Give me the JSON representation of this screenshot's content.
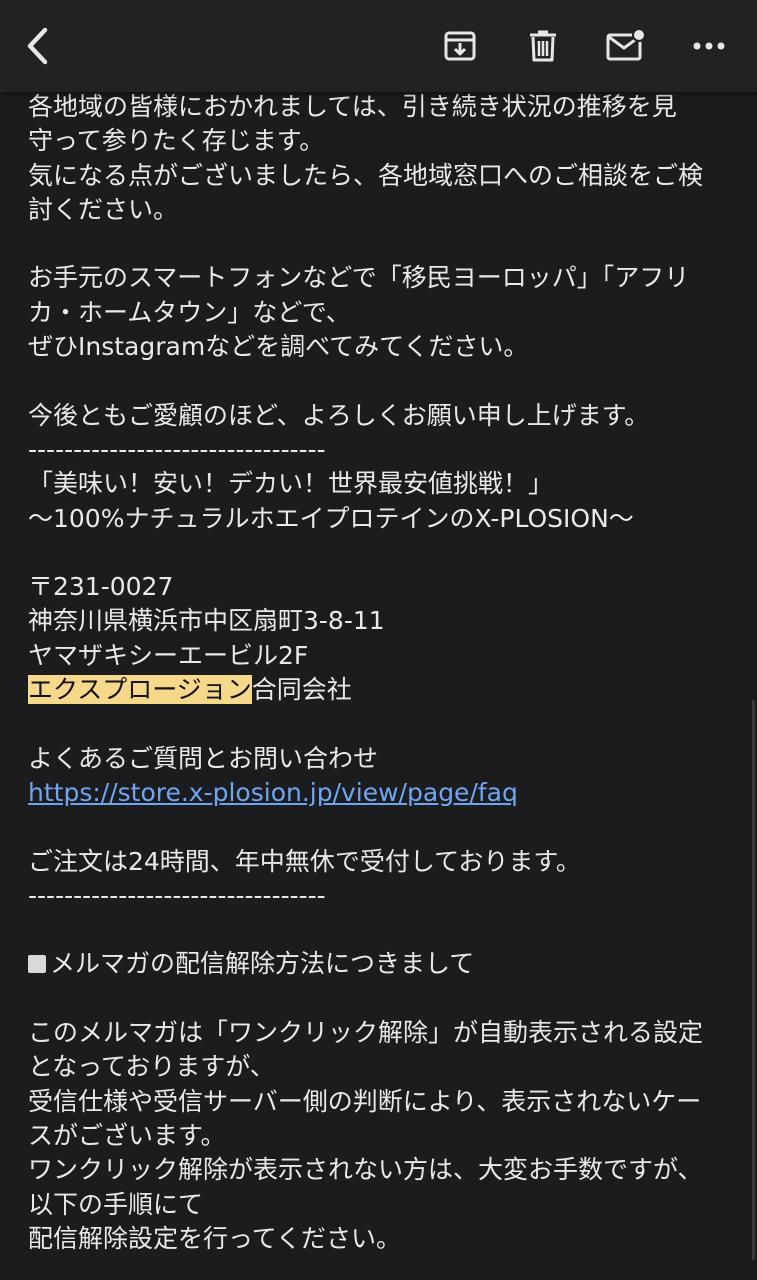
{
  "toolbar": {
    "back_icon": "chevron-left-icon",
    "archive_icon": "archive-icon",
    "delete_icon": "trash-icon",
    "mark_unread_icon": "mail-unread-icon",
    "more_icon": "more-horizontal-icon",
    "background": "#222225"
  },
  "email": {
    "lines": [
      "各地域の皆様におかれましては、引き続き状況の推移を見",
      "守って参りたく存じます。",
      "気になる点がございましたら、各地域窓口へのご相談をご検",
      "討ください。",
      "",
      "お手元のスマートフォンなどで「移民ヨーロッパ」「アフリ",
      "カ・ホームタウン」などで、",
      "ぜひInstagramなどを調べてみてください。",
      "",
      "今後ともご愛顧のほど、よろしくお願い申し上げます。",
      "---------------------------------",
      "「美味い！安い！デカい！世界最安値挑戦！」",
      "〜100%ナチュラルホエイプロテインのX-PLOSION〜",
      "",
      "〒231-0027",
      "神奈川県横浜市中区扇町3-8-11",
      "ヤマザキシーエービル2F"
    ],
    "company_highlight": "エクスプロージョン",
    "company_suffix": "合同会社",
    "faq_label": "よくあるご質問とお問い合わせ",
    "faq_link": "https://store.x-plosion.jp/view/page/faq",
    "hours": "ご注文は24時間、年中無休で受付しております。",
    "divider2": "---------------------------------",
    "unsubscribe_heading": "メルマガの配信解除方法につきまして",
    "unsubscribe_lines": [
      "このメルマガは「ワンクリック解除」が自動表示される設定",
      "となっておりますが、",
      "受信仕様や受信サーバー側の判断により、表示されないケー",
      "スがございます。",
      "ワンクリック解除が表示されない方は、大変お手数ですが、",
      "以下の手順にて",
      "配信解除設定を行ってください。"
    ]
  },
  "colors": {
    "background": "#1c1c1e",
    "text": "#e9e9eb",
    "link": "#6fa6f1",
    "highlight": "#f6d88a"
  }
}
